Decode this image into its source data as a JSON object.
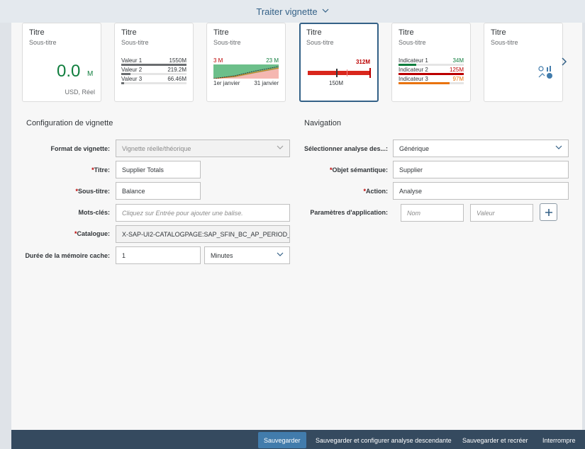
{
  "header": {
    "title": "Traiter vignette"
  },
  "tiles": [
    {
      "title": "Titre",
      "subtitle": "Sous-titre",
      "value": "0.0",
      "scale": "M",
      "unit": "USD, Réel"
    },
    {
      "title": "Titre",
      "subtitle": "Sous-titre",
      "rows": [
        {
          "label": "Valeur 1",
          "value": "1550M",
          "fraction": 1.0
        },
        {
          "label": "Valeur 2",
          "value": "219.2M",
          "fraction": 0.14
        },
        {
          "label": "Valeur 3",
          "value": "66.46M",
          "fraction": 0.04
        }
      ]
    },
    {
      "title": "Titre",
      "subtitle": "Sous-titre",
      "min": "3 M",
      "max": "23 M",
      "start": "1er janvier",
      "end": "31 janvier"
    },
    {
      "title": "Titre",
      "subtitle": "Sous-titre",
      "value": "312M",
      "target": "150M"
    },
    {
      "title": "Titre",
      "subtitle": "Sous-titre",
      "rows": [
        {
          "label": "Indicateur 1",
          "value": "34M",
          "color": "#107e3e"
        },
        {
          "label": "Indicateur 2",
          "value": "125M",
          "color": "#bb0000"
        },
        {
          "label": "Indicateur 3",
          "value": "97M",
          "color": "#e9730c"
        }
      ]
    },
    {
      "title": "Titre",
      "subtitle": "Sous-titre",
      "icon": "analytics-icon"
    }
  ],
  "config": {
    "title": "Configuration de vignette",
    "format_label": "Format de vignette:",
    "format_value": "Vignette réelle/théorique",
    "titre_label": "Titre:",
    "titre_value": "Supplier Totals",
    "soustitre_label": "Sous-titre:",
    "soustitre_value": "Balance",
    "keywords_label": "Mots-clés:",
    "keywords_placeholder": "Cliquez sur Entrée pour ajouter une balise.",
    "catalogue_label": "Catalogue:",
    "catalogue_value": "X-SAP-UI2-CATALOGPAGE:SAP_SFIN_BC_AP_PERIOD_",
    "cache_label": "Durée de la mémoire cache:",
    "cache_value": "1",
    "cache_unit": "Minutes"
  },
  "navigation": {
    "title": "Navigation",
    "analysis_label": "Sélectionner analyse des...:",
    "analysis_value": "Générique",
    "object_label": "Objet sémantique:",
    "object_value": "Supplier",
    "action_label": "Action:",
    "action_value": "Analyse",
    "params_label": "Paramètres d'application:",
    "param_name_placeholder": "Nom",
    "param_value_placeholder": "Valeur"
  },
  "footer": {
    "save": "Sauvegarder",
    "save_config": "Sauvegarder et configurer analyse descendante",
    "save_recreate": "Sauvegarder et recréer",
    "cancel": "Interrompre"
  }
}
